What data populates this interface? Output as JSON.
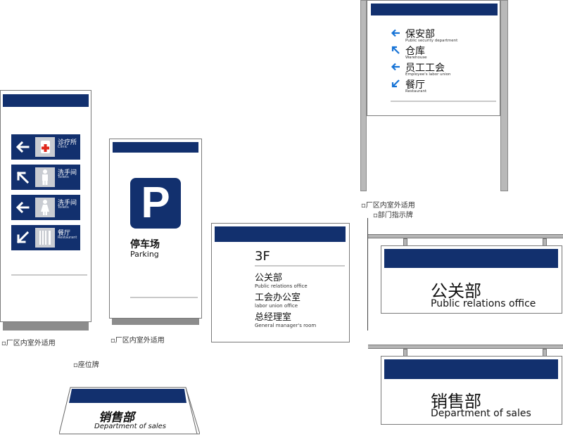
{
  "colors": {
    "navy": "#12306e",
    "arrow_blue": "#1673d6",
    "cross_red": "#e0271b",
    "pole_gray": "#b9b9b9"
  },
  "tall_sign": {
    "rows": [
      {
        "icon": "left-arrow-icon",
        "pictogram": "first-aid-icon",
        "zh": "诊疗所",
        "en": "Clinic"
      },
      {
        "icon": "up-left-arrow-icon",
        "pictogram": "man-icon",
        "zh": "洗手间",
        "en": "Toilets"
      },
      {
        "icon": "left-arrow-icon",
        "pictogram": "woman-icon",
        "zh": "洗手间",
        "en": "Toilets"
      },
      {
        "icon": "down-left-arrow-icon",
        "pictogram": "cutlery-icon",
        "zh": "餐厅",
        "en": "Restaurant"
      }
    ],
    "caption": "厂区内室外适用"
  },
  "parking_sign": {
    "symbol": "P",
    "zh": "停车场",
    "en": "Parking",
    "caption": "厂区内室外适用"
  },
  "floor_sign": {
    "floor": "3F",
    "rooms": [
      {
        "zh": "公关部",
        "en": "Public relations office"
      },
      {
        "zh": "工会办公室",
        "en": "labor union office"
      },
      {
        "zh": "总经理室",
        "en": "General manager's room"
      }
    ]
  },
  "directory_sign": {
    "items": [
      {
        "icon": "left-arrow-icon",
        "zh": "保安部",
        "en": "Public security department"
      },
      {
        "icon": "up-left-arrow-icon",
        "zh": "仓库",
        "en": "Warehouse"
      },
      {
        "icon": "left-arrow-icon",
        "zh": "员工工会",
        "en": "Employee's labor union"
      },
      {
        "icon": "down-left-arrow-icon",
        "zh": "餐厅",
        "en": "Restaurant"
      }
    ],
    "caption1": "厂区内室外适用",
    "caption2": "部门指示牌"
  },
  "hanging_signs": [
    {
      "zh": "公关部",
      "en": "Public relations office"
    },
    {
      "zh": "销售部",
      "en": "Department of sales"
    }
  ],
  "desk_sign": {
    "caption": "座位牌",
    "zh": "销售部",
    "en": "Department of sales"
  }
}
